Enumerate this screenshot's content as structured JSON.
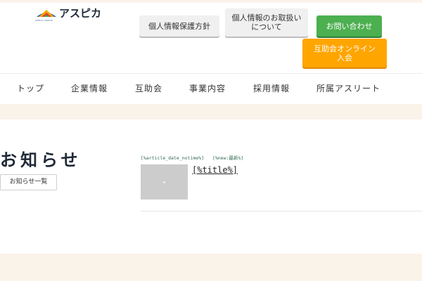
{
  "logo": {
    "text": "アスピカ",
    "sub": "ASPICA GROUP"
  },
  "header_buttons": {
    "privacy_policy": "個人情報保護方針",
    "privacy_handling": "個人情報のお取扱いについて",
    "contact": "お問い合わせ",
    "online_join": "互助会オンライン入会"
  },
  "nav": {
    "items": [
      "トップ",
      "企業情報",
      "互助会",
      "事業内容",
      "採用情報",
      "所属アスリート"
    ]
  },
  "news": {
    "heading": "お知らせ",
    "list_button": "お知らせ一覧",
    "article": {
      "date": "[%article_date_notime%]",
      "new_badge": "[%new:最新%]",
      "title": "[%title%]"
    }
  },
  "colors": {
    "accent_green": "#4caf50",
    "accent_orange": "#ffa500",
    "band_beige": "#faf3ea",
    "meta_green": "#2e6b4f"
  }
}
